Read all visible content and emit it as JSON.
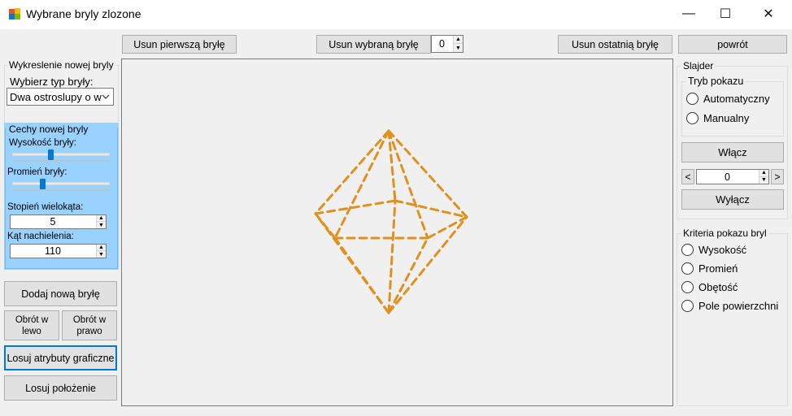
{
  "window": {
    "title": "Wybrane bryly zlozone",
    "minimize": "—",
    "maximize": "☐",
    "close": "✕"
  },
  "toolbar": {
    "remove_first": "Usun pierwszą bryłę",
    "remove_selected": "Usun wybraną bryłę",
    "selected_index": "0",
    "remove_last": "Usun ostatnią bryłę",
    "back": "powrót"
  },
  "left": {
    "new_solid_group": "Wykreslenie nowej bryly",
    "choose_type_label": "Wybierz typ bryły:",
    "solid_type_value": "Dwa ostroslupy o w",
    "features_group": "Cechy nowej bryly",
    "height_label": "Wysokość bryły:",
    "height_level": 0.4,
    "radius_label": "Promień bryły:",
    "radius_level": 0.3,
    "polygon_degree_label": "Stopień wielokąta:",
    "polygon_degree_value": "5",
    "tilt_label": "Kąt nachielenia:",
    "tilt_value": "110",
    "add_button": "Dodaj nową bryłę",
    "rotate_left": "Obrót w lewo",
    "rotate_right": "Obrót w prawo",
    "random_graphics": "Losuj atrybuty graficzne",
    "random_position": "Losuj położenie"
  },
  "right": {
    "slider_group": "Slajder",
    "mode_group": "Tryb pokazu",
    "mode_options": [
      "Automatyczny",
      "Manualny"
    ],
    "enable": "Włącz",
    "prev": "<",
    "next": ">",
    "slide_index": "0",
    "disable": "Wyłącz",
    "criteria_group": "Kriteria pokazu bryl",
    "criteria_options": [
      "Wysokość",
      "Promień",
      "Obętość",
      "Pole powierzchni"
    ]
  },
  "colors": {
    "solid_stroke": "#e0901c",
    "panel_blue": "#99d1ff",
    "accent": "#0078d7"
  }
}
